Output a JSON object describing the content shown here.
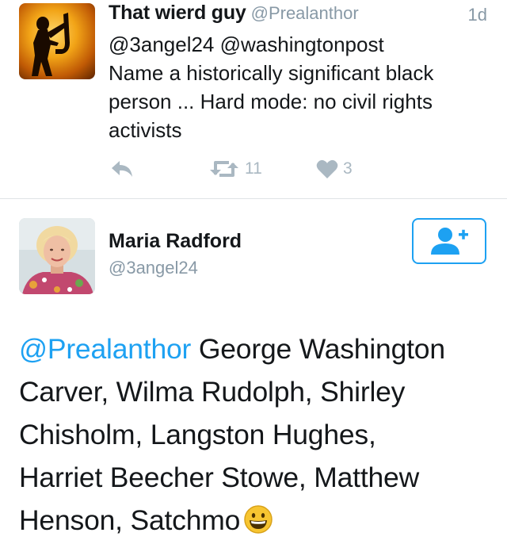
{
  "tweet1": {
    "author_name": "That wierd guy",
    "author_handle": "@Prealanthor",
    "timestamp": "1d",
    "text_lines": [
      "@3angel24 @washingtonpost",
      "Name a historically significant black",
      "person ... Hard mode: no civil rights",
      "activists"
    ],
    "retweet_count": "11",
    "like_count": "3",
    "avatar_icon": "saxophone-player-icon"
  },
  "tweet2": {
    "author_name": "Maria Radford",
    "author_handle": "@3angel24",
    "follow_icon": "add-user-icon",
    "mention": "@Prealanthor",
    "text_lines": [
      " George Washington",
      "Carver, Wilma Rudolph, Shirley",
      "Chisholm, Langston Hughes,",
      "Harriet Beecher Stowe, Matthew",
      "Henson, Satchmo"
    ],
    "emoji": "grinning-face-emoji"
  },
  "colors": {
    "accent": "#1da1f2",
    "muted": "#8899a6",
    "icon_gray": "#aab8c2",
    "text": "#14171a",
    "divider": "#dfe3e6"
  }
}
